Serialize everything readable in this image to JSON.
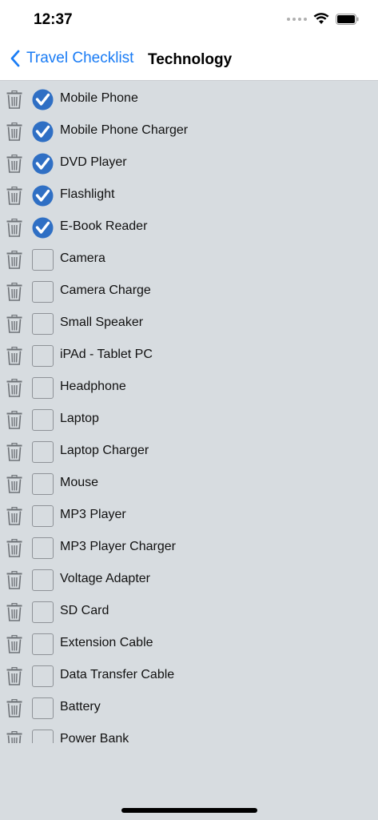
{
  "status": {
    "time": "12:37"
  },
  "nav": {
    "back_label": "Travel Checklist",
    "title": "Technology"
  },
  "colors": {
    "accent": "#1a7cf5",
    "check_fill": "#2f6fc4",
    "background": "#d7dce0"
  },
  "items": [
    {
      "label": "Mobile Phone",
      "checked": true
    },
    {
      "label": "Mobile Phone Charger",
      "checked": true
    },
    {
      "label": "DVD Player",
      "checked": true
    },
    {
      "label": "Flashlight",
      "checked": true
    },
    {
      "label": "E-Book Reader",
      "checked": true
    },
    {
      "label": "Camera",
      "checked": false
    },
    {
      "label": "Camera Charge",
      "checked": false
    },
    {
      "label": "Small Speaker",
      "checked": false
    },
    {
      "label": "iPAd - Tablet PC",
      "checked": false
    },
    {
      "label": "Headphone",
      "checked": false
    },
    {
      "label": "Laptop",
      "checked": false
    },
    {
      "label": "Laptop Charger",
      "checked": false
    },
    {
      "label": "Mouse",
      "checked": false
    },
    {
      "label": "MP3 Player",
      "checked": false
    },
    {
      "label": "MP3 Player Charger",
      "checked": false
    },
    {
      "label": "Voltage Adapter",
      "checked": false
    },
    {
      "label": "SD Card",
      "checked": false
    },
    {
      "label": "Extension Cable",
      "checked": false
    },
    {
      "label": "Data Transfer Cable",
      "checked": false
    },
    {
      "label": "Battery",
      "checked": false
    },
    {
      "label": "Power Bank",
      "checked": false
    }
  ]
}
